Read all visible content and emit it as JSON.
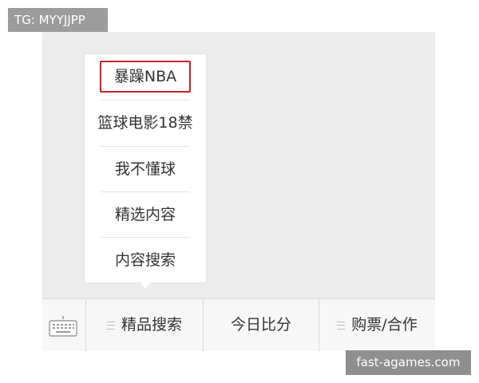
{
  "badge": {
    "text": "TG: MYYJJPP"
  },
  "popup_menu": {
    "items": [
      {
        "label": "暴躁NBA",
        "highlighted": true
      },
      {
        "label": "篮球电影18禁",
        "highlighted": false
      },
      {
        "label": "我不懂球",
        "highlighted": false
      },
      {
        "label": "精选内容",
        "highlighted": false
      },
      {
        "label": "内容搜索",
        "highlighted": false
      }
    ]
  },
  "bottom_bar": {
    "keyboard_icon": "keyboard-icon",
    "tabs": [
      {
        "label": "精品搜索",
        "has_menu": true
      },
      {
        "label": "今日比分",
        "has_menu": false
      },
      {
        "label": "购票/合作",
        "has_menu": true
      }
    ]
  },
  "watermark": {
    "text": "fast-agames.com"
  },
  "colors": {
    "highlight_border": "#c8202b",
    "background": "#ececec",
    "bar_background": "#f7f7f7",
    "text": "#333333"
  }
}
